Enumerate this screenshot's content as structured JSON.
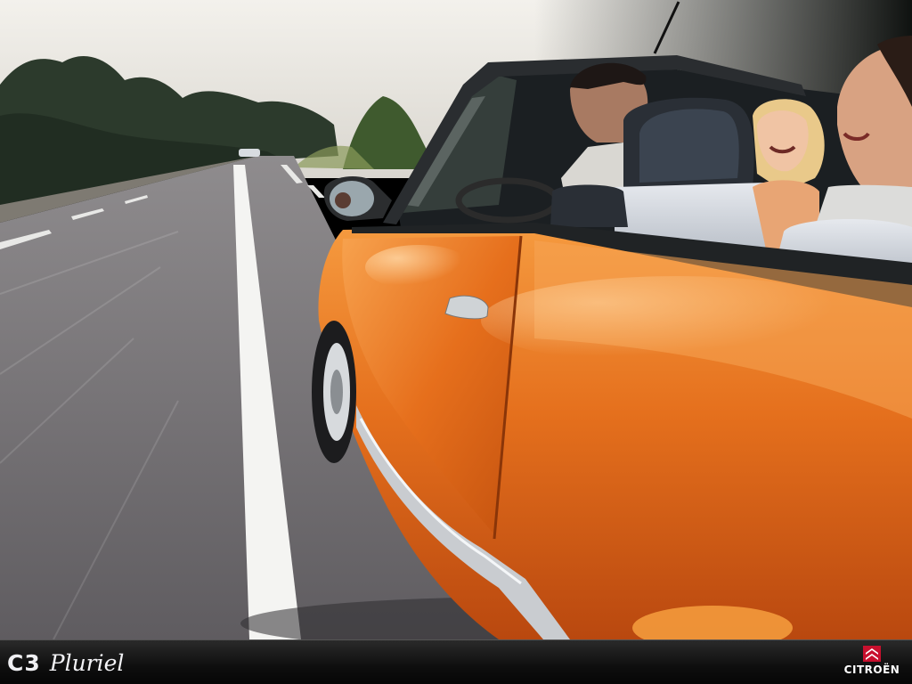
{
  "image": {
    "scene": "Orange convertible car driving fast on a tree-lined country road, two smiling passengers",
    "colors": {
      "car_body": "#e8701e",
      "road": "#6f6c6f",
      "sky": "#e9e7e2",
      "brand_bar": "#111111"
    }
  },
  "brand_bar": {
    "model_code": "C3",
    "model_name": "Pluriel",
    "maker_name": "CITROËN",
    "maker_icon": "double-chevron-icon"
  }
}
